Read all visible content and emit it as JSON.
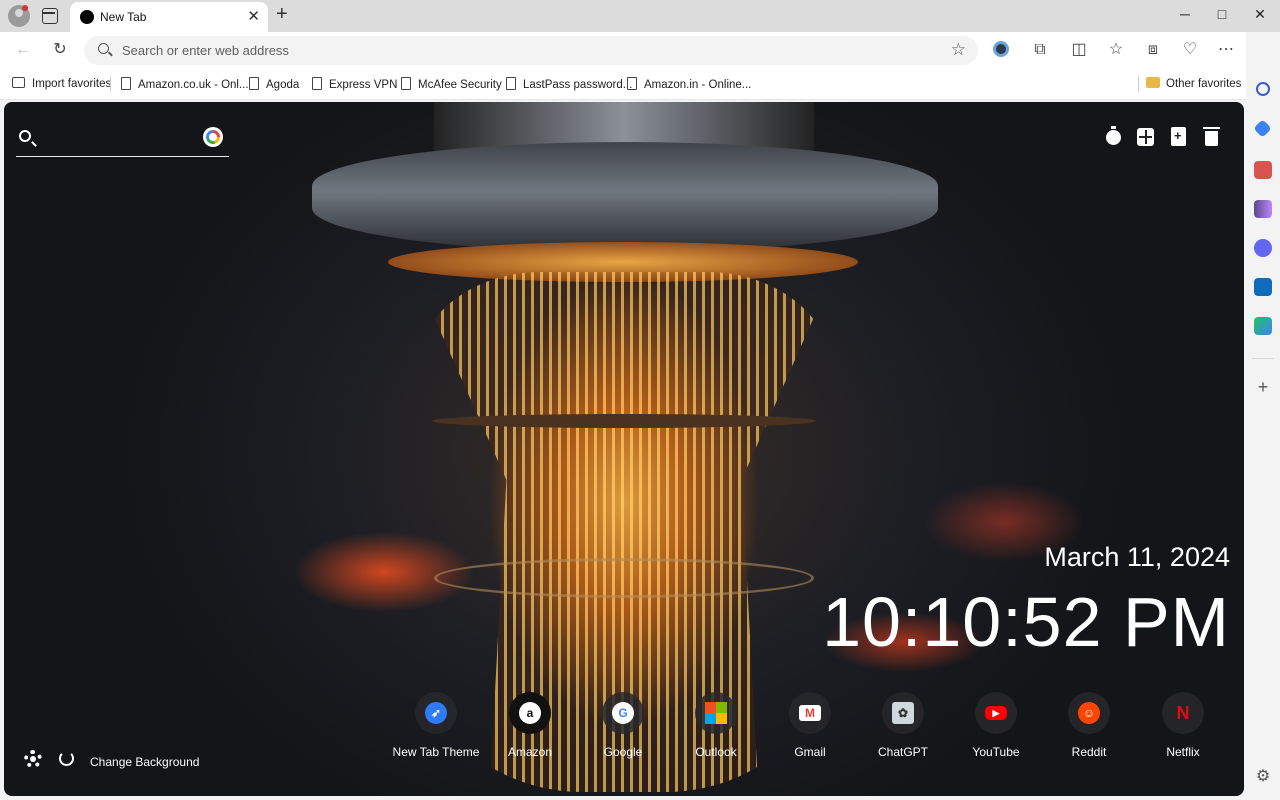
{
  "browser": {
    "tab": {
      "title": "New Tab"
    },
    "window_controls": {
      "minimize": "─",
      "maximize": "□",
      "close": "✕"
    },
    "address_bar": {
      "placeholder": "Search or enter web address"
    },
    "favorites": [
      {
        "label": "Import favorites",
        "icon": "import-icon"
      },
      {
        "label": "Amazon.co.uk - Onl...",
        "icon": "page-icon"
      },
      {
        "label": "Agoda",
        "icon": "page-icon"
      },
      {
        "label": "Express VPN",
        "icon": "page-icon"
      },
      {
        "label": "McAfee Security",
        "icon": "page-icon"
      },
      {
        "label": "LastPass password...",
        "icon": "page-icon"
      },
      {
        "label": "Amazon.in - Online...",
        "icon": "page-icon"
      }
    ],
    "other_favorites": "Other favorites"
  },
  "newtab": {
    "search": {
      "placeholder": ""
    },
    "date": "March 11, 2024",
    "time": "10:10:52 PM",
    "change_background": "Change Background",
    "shortcuts": [
      {
        "label": "New Tab Theme",
        "icon": "rocket-icon",
        "color": "#2f7bf6"
      },
      {
        "label": "Amazon",
        "icon": "amazon-icon",
        "color": "#ffffff"
      },
      {
        "label": "Google",
        "icon": "google-icon",
        "color": "#ffffff"
      },
      {
        "label": "Outlook",
        "icon": "microsoft-icon",
        "color": "#f25022"
      },
      {
        "label": "Gmail",
        "icon": "gmail-icon",
        "color": "#ea4335"
      },
      {
        "label": "ChatGPT",
        "icon": "chatgpt-icon",
        "color": "#cfd8dc"
      },
      {
        "label": "YouTube",
        "icon": "youtube-icon",
        "color": "#ff0000"
      },
      {
        "label": "Reddit",
        "icon": "reddit-icon",
        "color": "#ff4500"
      },
      {
        "label": "Netflix",
        "icon": "netflix-icon",
        "color": "#e50914"
      }
    ]
  },
  "colors": {
    "accent": "#2f7bf6",
    "tabbar": "#dcdcdc"
  }
}
